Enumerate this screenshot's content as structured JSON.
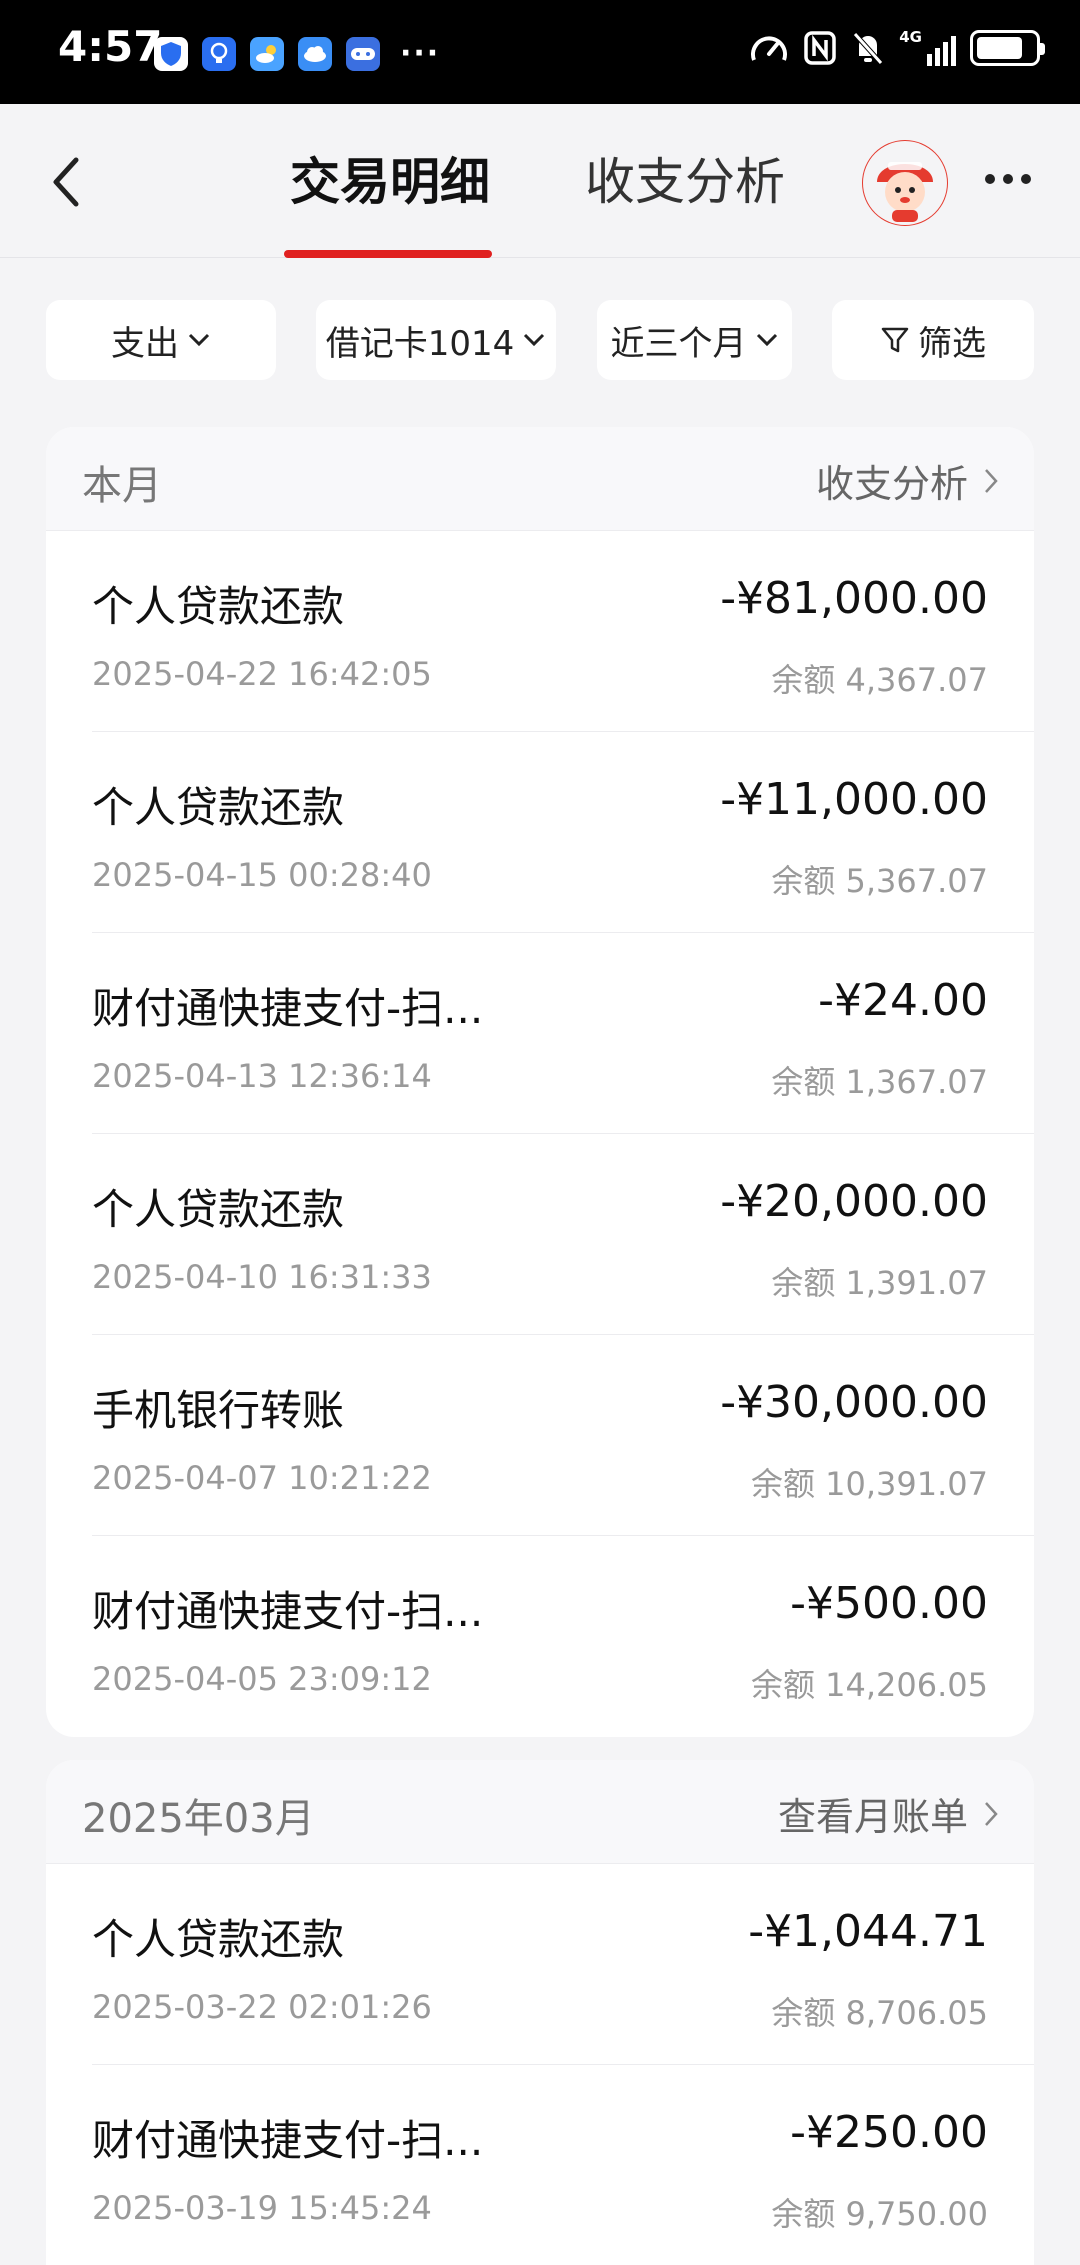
{
  "status_bar": {
    "time": "4:57",
    "more": "···",
    "network": "4G"
  },
  "header": {
    "tabs": [
      {
        "label": "交易明细",
        "active": true
      },
      {
        "label": "收支分析",
        "active": false
      }
    ],
    "accent_color": "#e02020"
  },
  "filters": {
    "type": "支出",
    "account": "借记卡1014",
    "period": "近三个月",
    "filter": "筛选"
  },
  "sections": [
    {
      "title": "本月",
      "link": "收支分析",
      "transactions": [
        {
          "name": "个人贷款还款",
          "amount": "-¥81,000.00",
          "time": "2025-04-22 16:42:05",
          "balance": "余额 4,367.07"
        },
        {
          "name": "个人贷款还款",
          "amount": "-¥11,000.00",
          "time": "2025-04-15 00:28:40",
          "balance": "余额 5,367.07"
        },
        {
          "name": "财付通快捷支付-扫...",
          "amount": "-¥24.00",
          "time": "2025-04-13 12:36:14",
          "balance": "余额 1,367.07"
        },
        {
          "name": "个人贷款还款",
          "amount": "-¥20,000.00",
          "time": "2025-04-10 16:31:33",
          "balance": "余额 1,391.07"
        },
        {
          "name": "手机银行转账",
          "amount": "-¥30,000.00",
          "time": "2025-04-07 10:21:22",
          "balance": "余额 10,391.07"
        },
        {
          "name": "财付通快捷支付-扫...",
          "amount": "-¥500.00",
          "time": "2025-04-05 23:09:12",
          "balance": "余额 14,206.05"
        }
      ]
    },
    {
      "title": "2025年03月",
      "link": "查看月账单",
      "transactions": [
        {
          "name": "个人贷款还款",
          "amount": "-¥1,044.71",
          "time": "2025-03-22 02:01:26",
          "balance": "余额 8,706.05"
        },
        {
          "name": "财付通快捷支付-扫...",
          "amount": "-¥250.00",
          "time": "2025-03-19 15:45:24",
          "balance": "余额 9,750.00"
        }
      ]
    }
  ]
}
